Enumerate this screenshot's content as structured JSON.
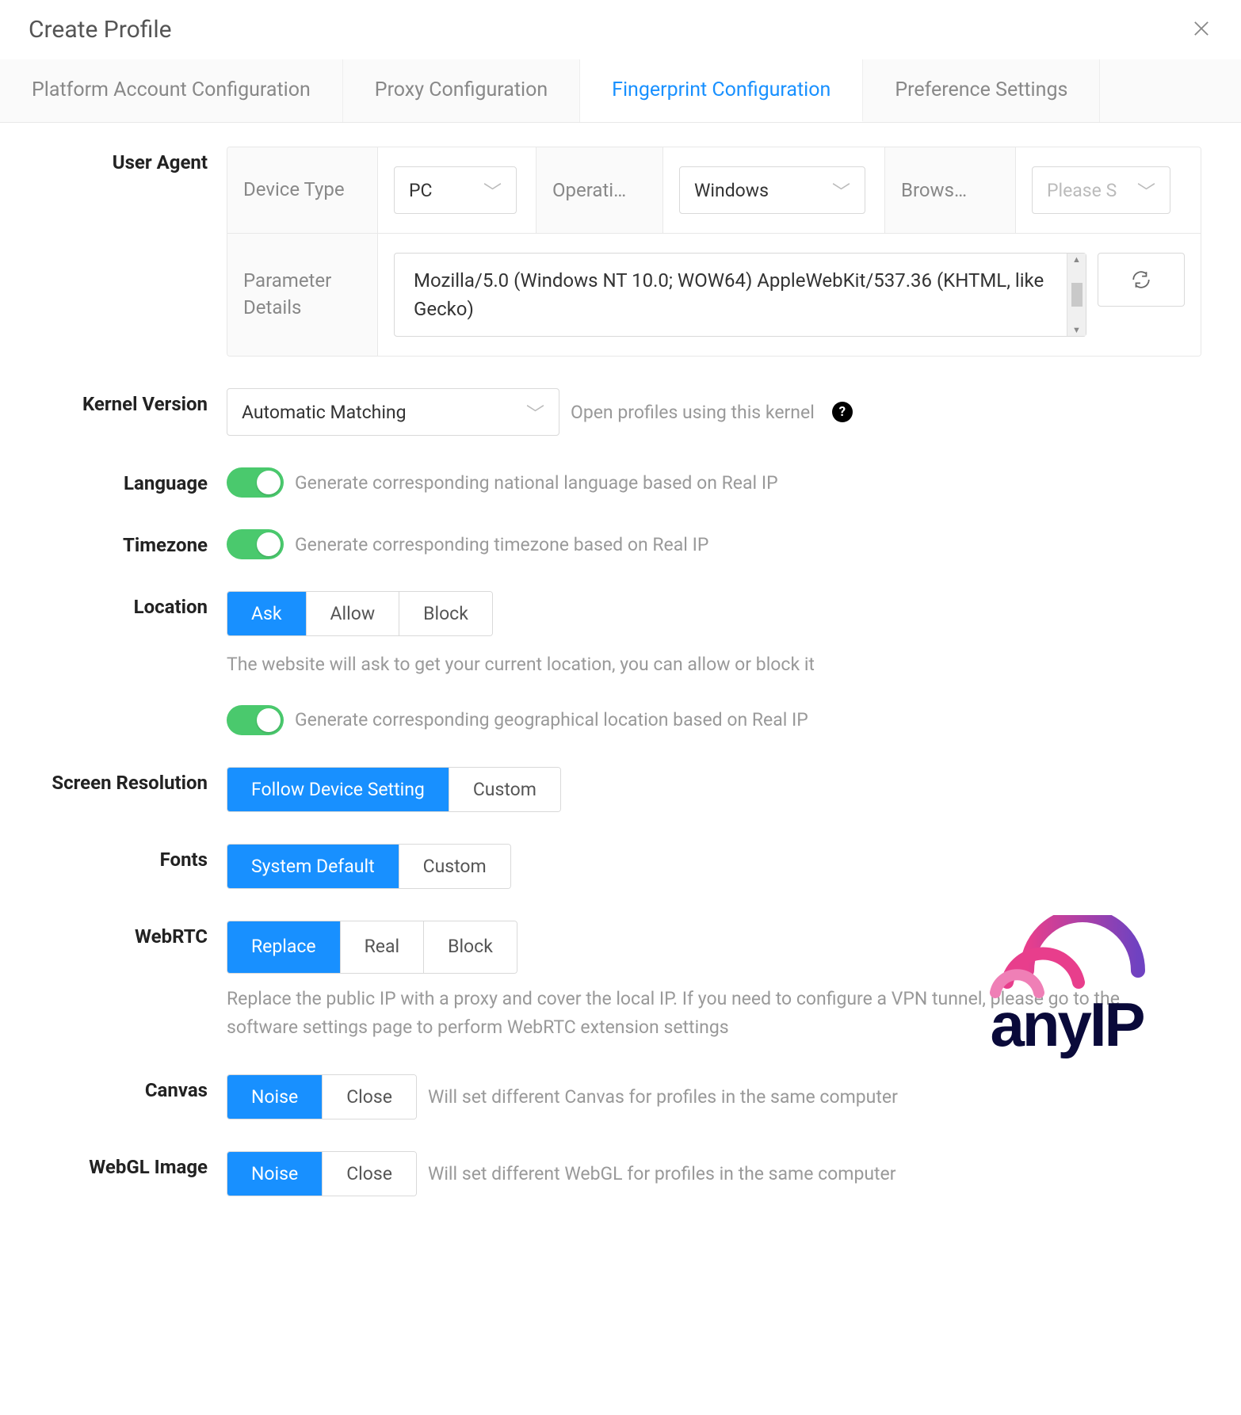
{
  "header": {
    "title": "Create Profile"
  },
  "tabs": [
    {
      "label": "Platform Account Configuration",
      "active": false
    },
    {
      "label": "Proxy Configuration",
      "active": false
    },
    {
      "label": "Fingerprint Configuration",
      "active": true
    },
    {
      "label": "Preference Settings",
      "active": false
    }
  ],
  "userAgent": {
    "label": "User Agent",
    "deviceTypeLabel": "Device Type",
    "deviceType": "PC",
    "osLabel": "Operati…",
    "os": "Windows",
    "browserLabel": "Brows…",
    "browserPlaceholder": "Please S",
    "paramLabel": "Parameter Details",
    "paramValue": "Mozilla/5.0 (Windows NT 10.0; WOW64) AppleWebKit/537.36 (KHTML, like Gecko)"
  },
  "kernel": {
    "label": "Kernel Version",
    "value": "Automatic Matching",
    "helper": "Open profiles using this kernel"
  },
  "language": {
    "label": "Language",
    "helper": "Generate corresponding national language based on Real IP"
  },
  "timezone": {
    "label": "Timezone",
    "helper": "Generate corresponding timezone based on Real IP"
  },
  "location": {
    "label": "Location",
    "options": [
      "Ask",
      "Allow",
      "Block"
    ],
    "active": "Ask",
    "desc": "The website will ask to get your current location, you can allow or block it",
    "toggleHelper": "Generate corresponding geographical location based on Real IP"
  },
  "screenRes": {
    "label": "Screen Resolution",
    "options": [
      "Follow Device Setting",
      "Custom"
    ],
    "active": "Follow Device Setting"
  },
  "fonts": {
    "label": "Fonts",
    "options": [
      "System Default",
      "Custom"
    ],
    "active": "System Default"
  },
  "webrtc": {
    "label": "WebRTC",
    "options": [
      "Replace",
      "Real",
      "Block"
    ],
    "active": "Replace",
    "desc": "Replace the public IP with a proxy and cover the local IP. If you need to configure a VPN tunnel, please go to the software settings page to perform WebRTC extension settings"
  },
  "canvas": {
    "label": "Canvas",
    "options": [
      "Noise",
      "Close"
    ],
    "active": "Noise",
    "desc": "Will set different Canvas for profiles in the same computer"
  },
  "webgl": {
    "label": "WebGL Image",
    "options": [
      "Noise",
      "Close"
    ],
    "active": "Noise",
    "desc": "Will set different WebGL for profiles in the same computer"
  },
  "watermark": "anyIP"
}
